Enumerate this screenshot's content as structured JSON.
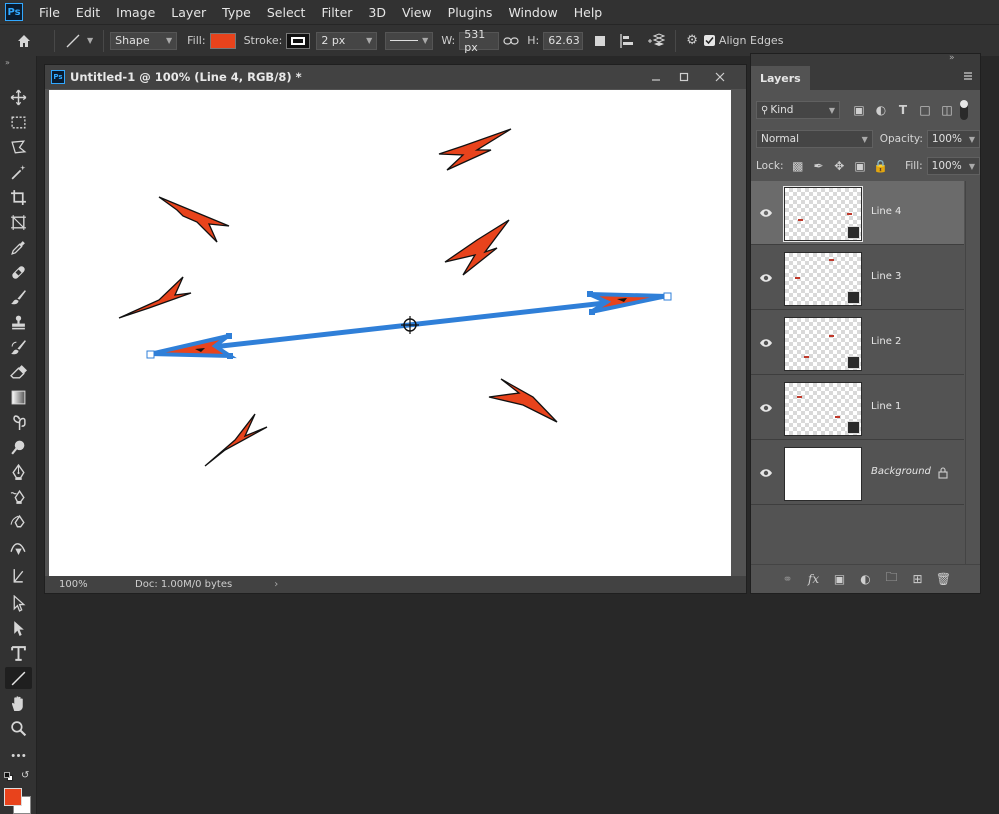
{
  "app": {
    "logo": "Ps"
  },
  "menu": [
    "File",
    "Edit",
    "Image",
    "Layer",
    "Type",
    "Select",
    "Filter",
    "3D",
    "View",
    "Plugins",
    "Window",
    "Help"
  ],
  "options": {
    "mode": "Shape",
    "fill_label": "Fill:",
    "fill_color": "#e8431c",
    "stroke_label": "Stroke:",
    "stroke_width": "2 px",
    "w_label": "W:",
    "w_value": "531 px",
    "h_label": "H:",
    "h_value": "62.63 px",
    "align_edges": "Align Edges",
    "align_edges_checked": true
  },
  "document": {
    "title": "Untitled-1 @ 100% (Line 4, RGB/8) *",
    "zoom": "100%",
    "doc_info": "Doc: 1.00M/0 bytes"
  },
  "colors": {
    "arrow_fill": "#e8431c",
    "path_selection": "#2f7fd8",
    "foreground": "#e8431c",
    "background": "#ffffff"
  },
  "layers_panel": {
    "tab": "Layers",
    "filter_kind": "Kind",
    "blend_mode": "Normal",
    "opacity_label": "Opacity:",
    "opacity_value": "100%",
    "lock_label": "Lock:",
    "fill_label": "Fill:",
    "fill_value": "100%",
    "layers": [
      {
        "name": "Line 4",
        "selected": true,
        "type": "shape"
      },
      {
        "name": "Line 3",
        "selected": false,
        "type": "shape"
      },
      {
        "name": "Line 2",
        "selected": false,
        "type": "shape"
      },
      {
        "name": "Line 1",
        "selected": false,
        "type": "shape"
      },
      {
        "name": "Background",
        "selected": false,
        "type": "background",
        "locked": true
      }
    ]
  }
}
